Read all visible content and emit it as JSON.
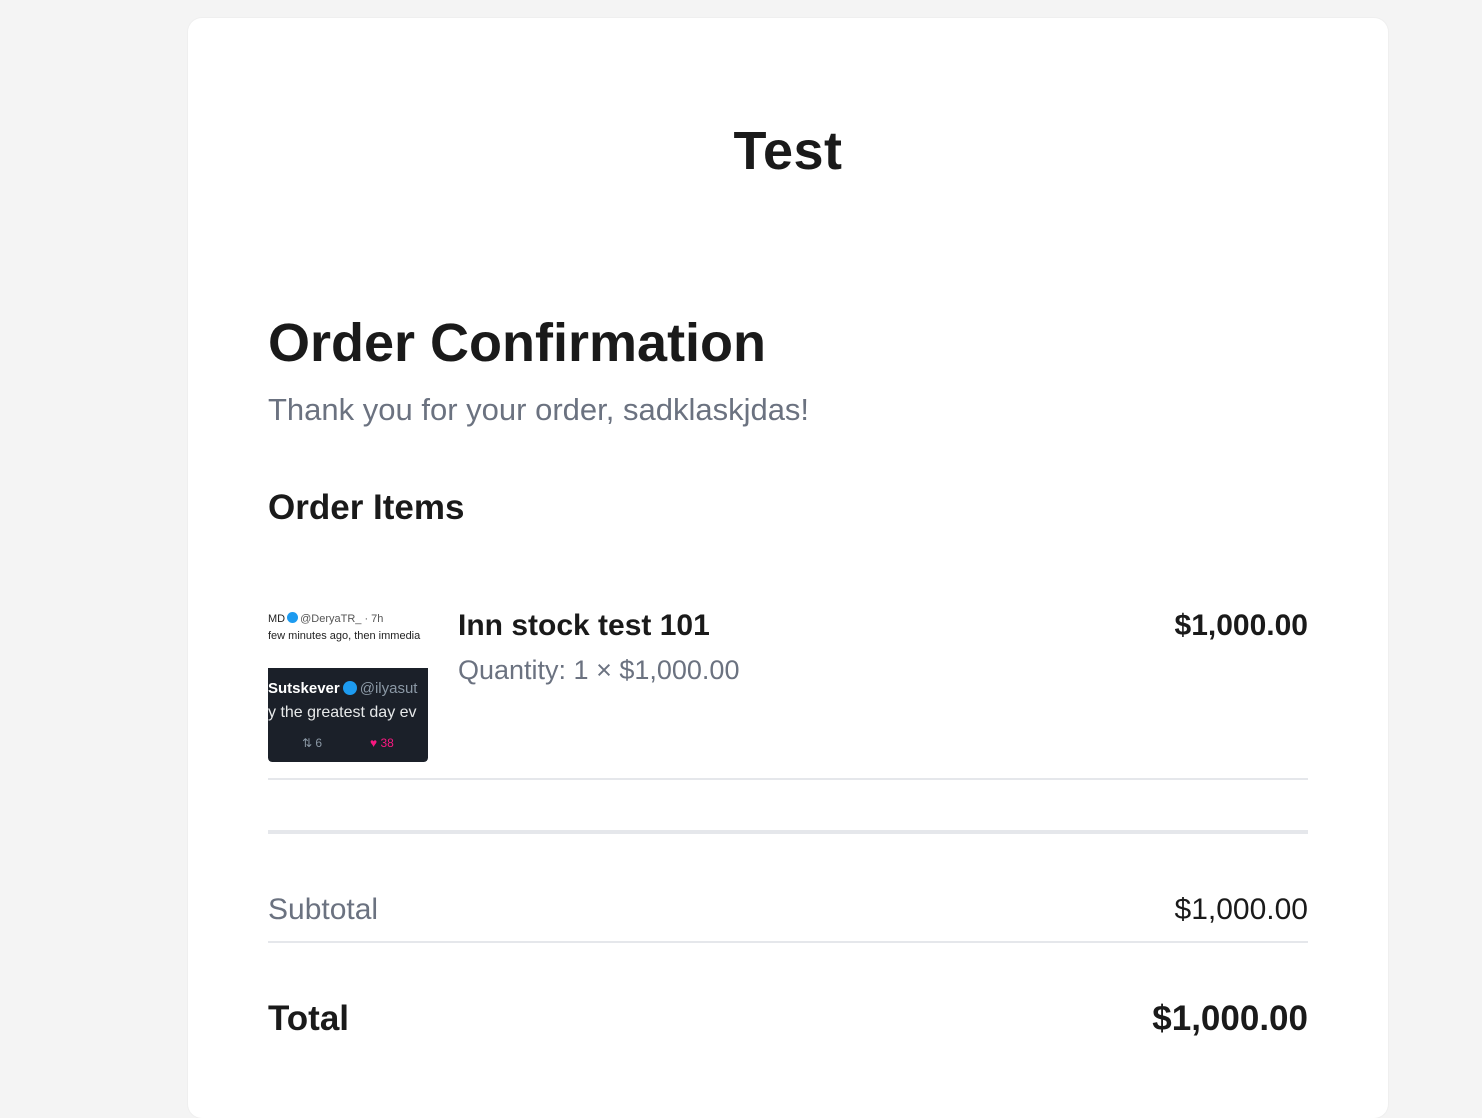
{
  "store": {
    "name": "Test"
  },
  "order": {
    "title": "Order Confirmation",
    "thank_you": "Thank you for your order, sadklaskjdas!",
    "items_heading": "Order Items",
    "items": [
      {
        "name": "Inn stock test 101",
        "quantity_line": "Quantity: 1 × $1,000.00",
        "price": "$1,000.00",
        "thumbnail": {
          "top_author": "MD",
          "top_handle": "@DeryaTR_ · 7h",
          "top_text": "few minutes ago, then immedia",
          "bottom_author": "Sutskever",
          "bottom_handle": "@ilyasut",
          "bottom_text": "y the greatest day ev",
          "retweets": "6",
          "likes": "38"
        }
      }
    ],
    "subtotal_label": "Subtotal",
    "subtotal_value": "$1,000.00",
    "total_label": "Total",
    "total_value": "$1,000.00"
  }
}
